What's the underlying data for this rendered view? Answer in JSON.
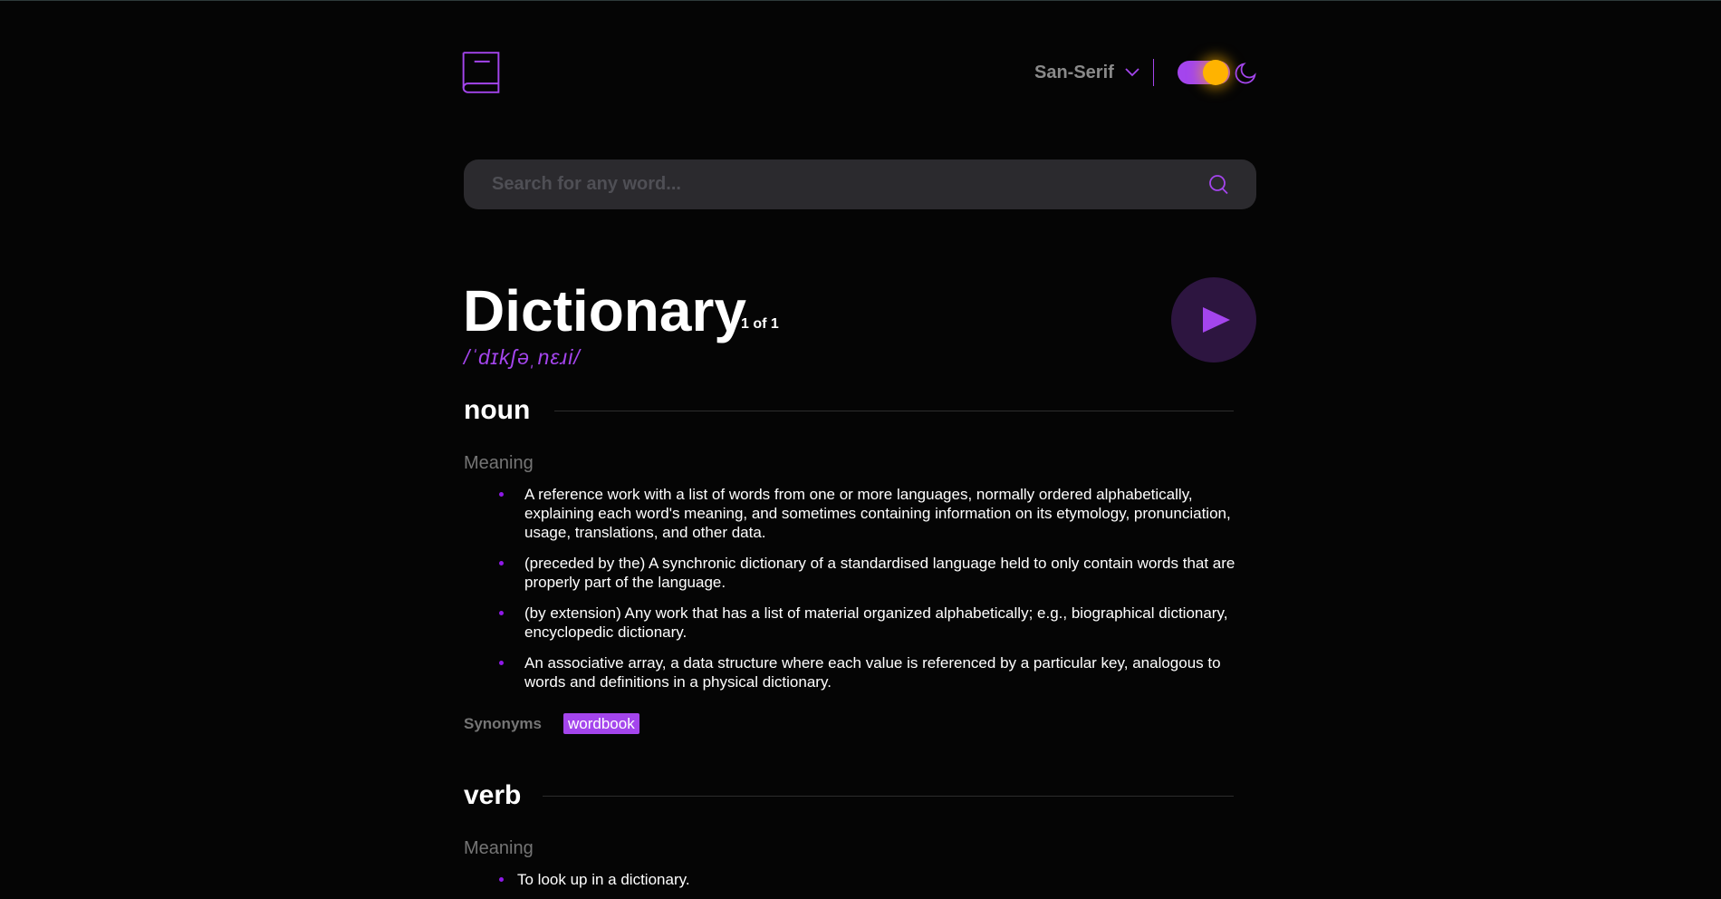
{
  "header": {
    "font_selected": "San-Serif",
    "theme": "dark",
    "accent_color": "#a445ed",
    "toggle_color": "#ffb300",
    "icons": [
      "book-logo-icon",
      "chevron-down-icon",
      "moon-icon",
      "search-icon",
      "play-icon"
    ]
  },
  "search": {
    "placeholder": "Search for any word...",
    "value": ""
  },
  "entry": {
    "word": "Dictionary",
    "result_count": "1 of 1",
    "phonetic": "/ˈdɪkʃəˌnɛɹi/"
  },
  "meanings": [
    {
      "part_of_speech": "noun",
      "heading": "Meaning",
      "definitions": [
        "A reference work with a list of words from one or more languages, normally ordered alphabetically, explaining each word's meaning, and sometimes containing information on its etymology, pronunciation, usage, translations, and other data.",
        "(preceded by the) A synchronic dictionary of a standardised language held to only contain words that are properly part of the language.",
        "(by extension) Any work that has a list of material organized alphabetically; e.g., biographical dictionary, encyclopedic dictionary.",
        "An associative array, a data structure where each value is referenced by a particular key, analogous to words and definitions in a physical dictionary."
      ],
      "synonyms_label": "Synonyms",
      "synonyms": [
        "wordbook"
      ]
    },
    {
      "part_of_speech": "verb",
      "heading": "Meaning",
      "definitions": [
        "To look up in a dictionary."
      ]
    }
  ]
}
